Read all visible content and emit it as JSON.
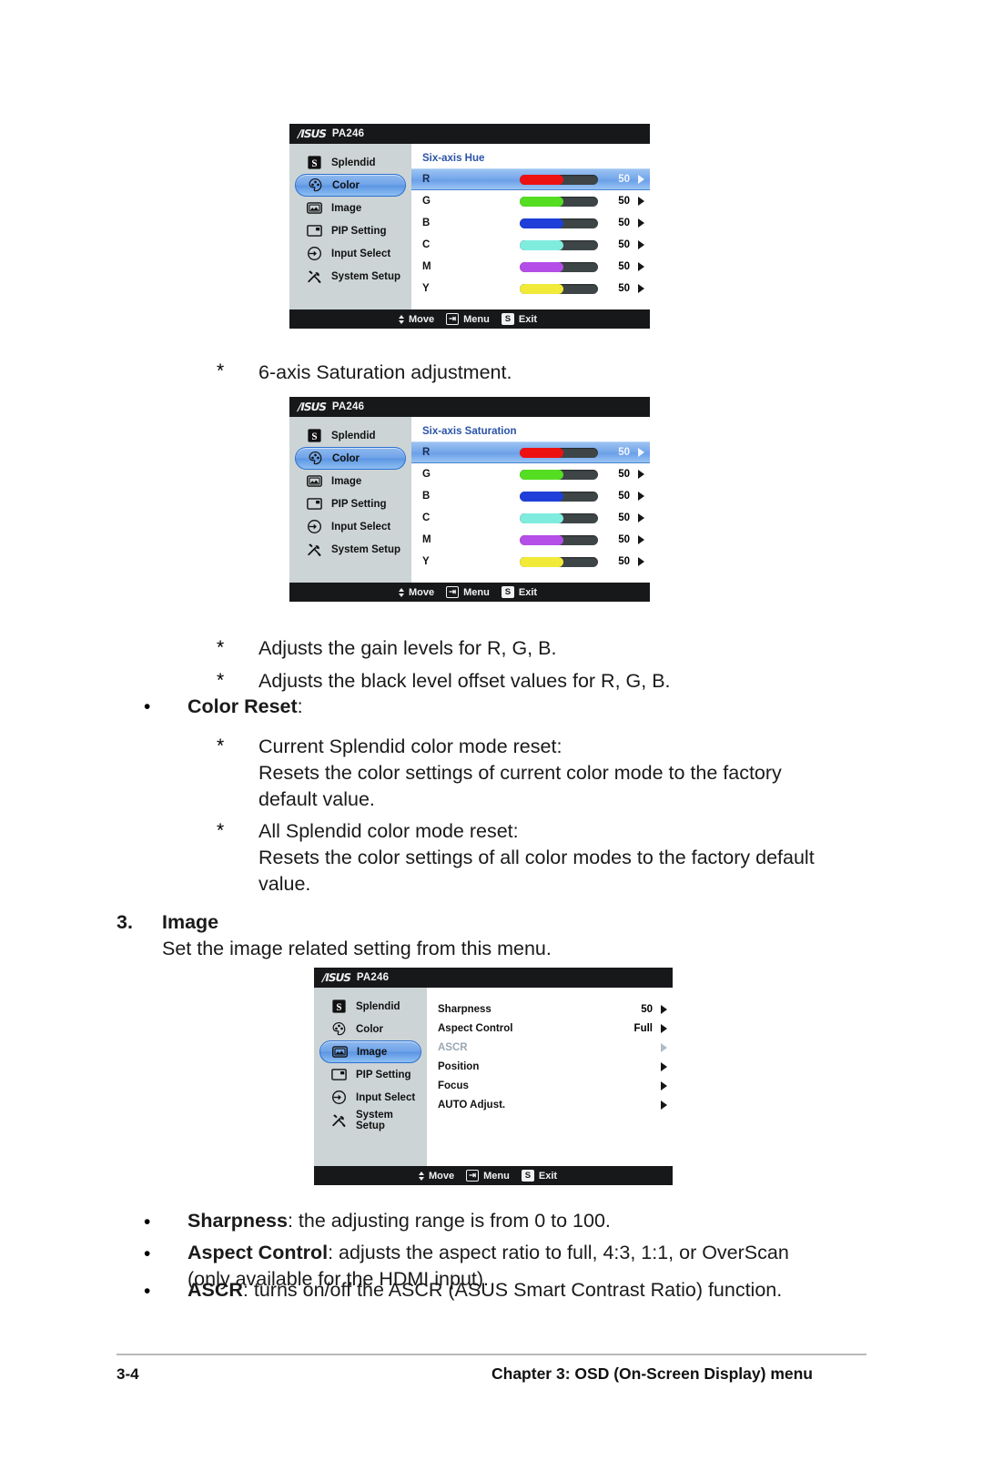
{
  "document": {
    "page_number": "3-4",
    "chapter_footer": "Chapter 3: OSD (On-Screen Display) menu"
  },
  "osd_common": {
    "brand": "/ISUS",
    "model": "PA246",
    "sidebar": [
      {
        "label": "Splendid",
        "icon": "splendid-s-icon"
      },
      {
        "label": "Color",
        "icon": "color-palette-icon"
      },
      {
        "label": "Image",
        "icon": "image-picture-icon"
      },
      {
        "label": "PIP Setting",
        "icon": "pip-window-icon"
      },
      {
        "label": "Input Select",
        "icon": "input-arrow-icon"
      },
      {
        "label": "System Setup",
        "icon": "tools-wrench-icon"
      }
    ],
    "footer": {
      "move": "Move",
      "menu": "Menu",
      "exit": "Exit",
      "exit_key": "S"
    }
  },
  "osd_hue": {
    "section_title": "Six-axis Hue",
    "selected_sidebar": "Color",
    "rows": [
      {
        "label": "R",
        "value": "50",
        "color": "#ee1111",
        "fill_pct": 56,
        "selected": true
      },
      {
        "label": "G",
        "value": "50",
        "color": "#55dd22",
        "fill_pct": 56,
        "selected": false
      },
      {
        "label": "B",
        "value": "50",
        "color": "#1f3fd8",
        "fill_pct": 56,
        "selected": false
      },
      {
        "label": "C",
        "value": "50",
        "color": "#7fecde",
        "fill_pct": 56,
        "selected": false
      },
      {
        "label": "M",
        "value": "50",
        "color": "#b44ee8",
        "fill_pct": 56,
        "selected": false
      },
      {
        "label": "Y",
        "value": "50",
        "color": "#f2ea38",
        "fill_pct": 56,
        "selected": false
      }
    ]
  },
  "osd_saturation": {
    "section_title": "Six-axis Saturation",
    "selected_sidebar": "Color",
    "rows": [
      {
        "label": "R",
        "value": "50",
        "color": "#ee1111",
        "fill_pct": 56,
        "selected": true
      },
      {
        "label": "G",
        "value": "50",
        "color": "#55dd22",
        "fill_pct": 56,
        "selected": false
      },
      {
        "label": "B",
        "value": "50",
        "color": "#1f3fd8",
        "fill_pct": 56,
        "selected": false
      },
      {
        "label": "C",
        "value": "50",
        "color": "#7fecde",
        "fill_pct": 56,
        "selected": false
      },
      {
        "label": "M",
        "value": "50",
        "color": "#b44ee8",
        "fill_pct": 56,
        "selected": false
      },
      {
        "label": "Y",
        "value": "50",
        "color": "#f2ea38",
        "fill_pct": 56,
        "selected": false
      }
    ]
  },
  "osd_image": {
    "selected_sidebar": "Image",
    "rows": [
      {
        "label": "Sharpness",
        "value": "50",
        "dim": false
      },
      {
        "label": "Aspect Control",
        "value": "Full",
        "dim": false
      },
      {
        "label": "ASCR",
        "value": "",
        "dim": true
      },
      {
        "label": "Position",
        "value": "",
        "dim": false
      },
      {
        "label": "Focus",
        "value": "",
        "dim": false
      },
      {
        "label": "AUTO Adjust.",
        "value": "",
        "dim": false
      }
    ]
  },
  "body": {
    "note_saturation_star": "*",
    "note_saturation": "6-axis Saturation adjustment.",
    "gain_star": "*",
    "gain": "Adjusts the gain levels for R, G, B.",
    "black_star": "*",
    "black": "Adjusts the black level offset values for R, G, B.",
    "color_reset_bullet": "•",
    "color_reset_bold": "Color Reset",
    "color_reset_colon": ":",
    "cur_star": "*",
    "cur_title": "Current Splendid color mode reset:",
    "cur_desc_line1": "Resets the color settings of current color mode to the factory",
    "cur_desc_line2": "default value.",
    "all_star": "*",
    "all_title": "All Splendid color mode reset:",
    "all_desc_line1": "Resets the color settings of all color modes to the factory default",
    "all_desc_line2": "value.",
    "sec3_num": "3.",
    "sec3_title": "Image",
    "sec3_sub": "Set the image related setting from this menu.",
    "b1_bullet": "•",
    "b1_bold": "Sharpness",
    "b1_rest": ": the adjusting range is from 0 to 100.",
    "b2_bullet": "•",
    "b2_bold": "Aspect Control",
    "b2_rest": ": adjusts the aspect ratio to full, 4:3, 1:1, or OverScan",
    "b2_line2": "(only available for the HDMI input).",
    "b3_bullet": "•",
    "b3_bold": "ASCR",
    "b3_rest": ": turns on/off the ASCR (ASUS Smart Contrast Ratio) function."
  }
}
